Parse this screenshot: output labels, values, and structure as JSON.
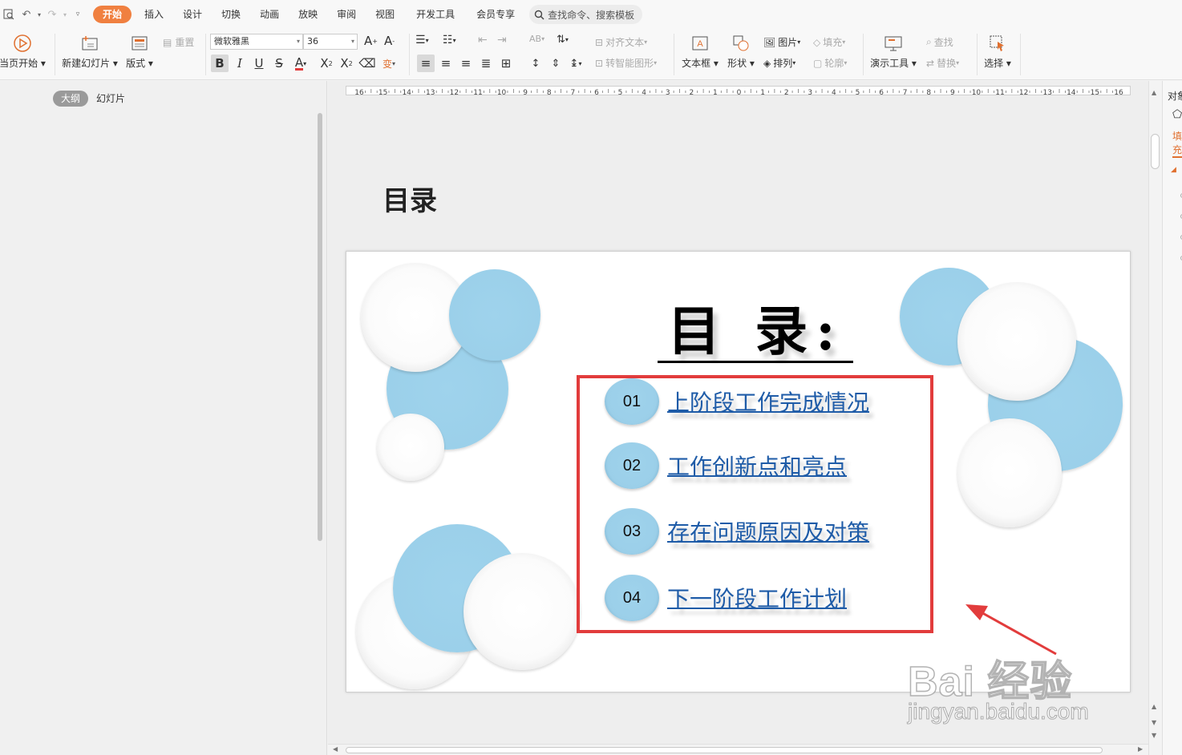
{
  "menu": {
    "tabs": [
      {
        "label": "开始",
        "active": true
      },
      {
        "label": "插入"
      },
      {
        "label": "设计"
      },
      {
        "label": "切换"
      },
      {
        "label": "动画"
      },
      {
        "label": "放映"
      },
      {
        "label": "审阅"
      },
      {
        "label": "视图"
      },
      {
        "label": "开发工具"
      },
      {
        "label": "会员专享"
      }
    ],
    "search_placeholder": "查找命令、搜索模板"
  },
  "ribbon": {
    "play_from_current": "当页开始",
    "new_slide": "新建幻灯片",
    "layout": "版式",
    "reset": "重置",
    "font_name": "微软雅黑",
    "font_size": "36",
    "align_text": "对齐文本",
    "smart_shape": "转智能图形",
    "textbox": "文本框",
    "shape": "形状",
    "picture": "图片",
    "arrange": "排列",
    "fill": "填充",
    "outline": "轮廓",
    "presenter_tools": "演示工具",
    "find": "查找",
    "replace": "替换",
    "select": "选择"
  },
  "left_panel": {
    "tabs": [
      {
        "label": "大纲",
        "active": true
      },
      {
        "label": "幻灯片"
      }
    ]
  },
  "outline": {
    "title": "目录"
  },
  "slide": {
    "title": "目 录:",
    "items": [
      {
        "num": "01",
        "text": "上阶段工作完成情况"
      },
      {
        "num": "02",
        "text": "工作创新点和亮点"
      },
      {
        "num": "03",
        "text": "存在问题原因及对策"
      },
      {
        "num": "04",
        "text": "下一阶段工作计划"
      }
    ],
    "accent_red": "#e23c3c",
    "link_blue": "#1f5ca8",
    "ball_blue": "#9bd0ea"
  },
  "right_panel": {
    "title": "对象属性",
    "tab": "填充"
  },
  "ruler": {
    "labels": [
      "16",
      "15",
      "14",
      "13",
      "12",
      "11",
      "10",
      "9",
      "8",
      "7",
      "6",
      "5",
      "4",
      "3",
      "2",
      "1",
      "0",
      "1",
      "2",
      "3",
      "4",
      "5",
      "6",
      "7",
      "8",
      "9",
      "10",
      "11",
      "12",
      "13",
      "14",
      "15",
      "16"
    ]
  },
  "watermark": {
    "logo": "Bai 经验",
    "url": "jingyan.baidu.com"
  },
  "colors": {
    "active_tab": "#f08040"
  }
}
